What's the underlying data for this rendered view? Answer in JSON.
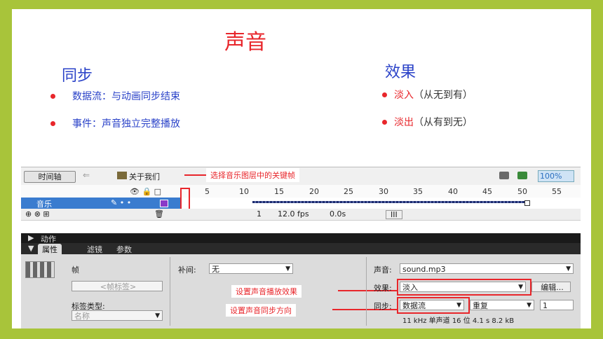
{
  "slide": {
    "title": "声音",
    "sync_heading": "同步",
    "sync_items": [
      {
        "text": "数据流：与动画同步结束"
      },
      {
        "text": "事件：声音独立完整播放"
      }
    ],
    "effect_heading": "效果",
    "effect_items": [
      {
        "term": "淡入",
        "desc": "（从无到有）"
      },
      {
        "term": "淡出",
        "desc": "（从有到无）"
      }
    ]
  },
  "flash_ui": {
    "timeline_button": "时间轴",
    "back_arrow": "⇐",
    "scene_name": "关于我们",
    "callout_keyframe": "选择音乐图层中的关键帧",
    "zoom": "100%",
    "layer_icons": "👁 🔒 □",
    "ruler_numbers": [
      "5",
      "10",
      "15",
      "20",
      "25",
      "30",
      "35",
      "40",
      "45",
      "50",
      "55"
    ],
    "layer_name": "音乐",
    "layer_controls": "✎ • •",
    "status_frame": "1",
    "status_fps": "12.0 fps",
    "status_time": "0.0s",
    "status_scroll": "III",
    "panel_actions": "动作",
    "tabs": [
      "属性",
      "滤镜",
      "参数"
    ],
    "frame_label": "帧",
    "frame_label_placeholder": "<帧标签>",
    "tween_label": "补间:",
    "tween_value": "无",
    "label_type": "标签类型:",
    "label_type_value": "名称",
    "sound_label": "声音:",
    "sound_value": "sound.mp3",
    "effect_label": "效果:",
    "effect_value": "淡入",
    "edit_button": "编辑...",
    "sync_label": "同步:",
    "sync_value": "数据流",
    "repeat_value": "重复",
    "repeat_count": "1",
    "sound_info": "11 kHz 单声道 16 位 4.1 s 8.2 kB",
    "callout_effect": "设置声音播放效果",
    "callout_sync": "设置声音同步方向"
  },
  "colors": {
    "frame": "#a8c43a",
    "title_red": "#e8262b",
    "heading_blue": "#2a42c8"
  }
}
